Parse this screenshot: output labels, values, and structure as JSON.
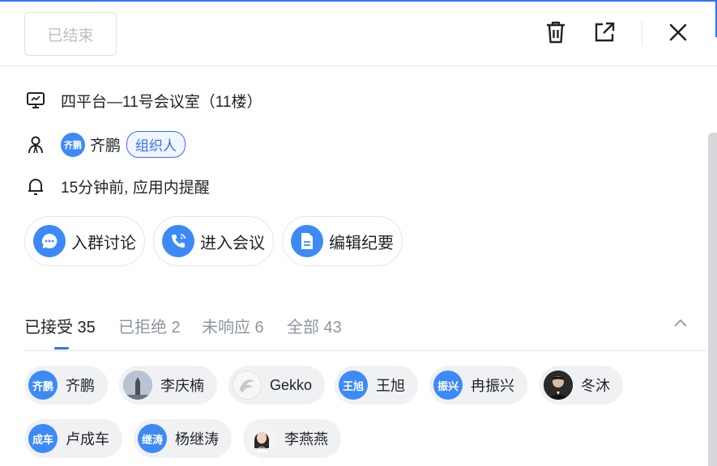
{
  "header": {
    "status_label": "已结束"
  },
  "info": {
    "room": "四平台—11号会议室（11楼）",
    "organizer": {
      "avatar_text": "齐鹏",
      "name": "齐鹏",
      "badge": "组织人"
    },
    "reminder": "15分钟前, 应用内提醒"
  },
  "actions": [
    {
      "label": "入群讨论",
      "icon": "chat-icon"
    },
    {
      "label": "进入会议",
      "icon": "phone-icon"
    },
    {
      "label": "编辑纪要",
      "icon": "document-icon"
    }
  ],
  "tabs": [
    {
      "label": "已接受 35",
      "active": true
    },
    {
      "label": "已拒绝 2",
      "active": false
    },
    {
      "label": "未响应 6",
      "active": false
    },
    {
      "label": "全部 43",
      "active": false
    }
  ],
  "attendees": [
    {
      "name": "齐鹏",
      "avatar_text": "齐鹏",
      "avatar": "text"
    },
    {
      "name": "李庆楠",
      "avatar_text": "",
      "avatar": "photo-statue"
    },
    {
      "name": "Gekko",
      "avatar_text": "",
      "avatar": "photo-gecko"
    },
    {
      "name": "王旭",
      "avatar_text": "王旭",
      "avatar": "text"
    },
    {
      "name": "冉振兴",
      "avatar_text": "振兴",
      "avatar": "text"
    },
    {
      "name": "冬沐",
      "avatar_text": "",
      "avatar": "photo-person-dark"
    },
    {
      "name": "卢成车",
      "avatar_text": "成车",
      "avatar": "text"
    },
    {
      "name": "杨继涛",
      "avatar_text": "继涛",
      "avatar": "text"
    },
    {
      "name": "李燕燕",
      "avatar_text": "",
      "avatar": "photo-woman"
    }
  ],
  "colors": {
    "accent": "#3370ff",
    "avatar_blue": "#3d8af7",
    "chip_bg": "#f0f1f3",
    "muted_text": "#8f959e"
  }
}
